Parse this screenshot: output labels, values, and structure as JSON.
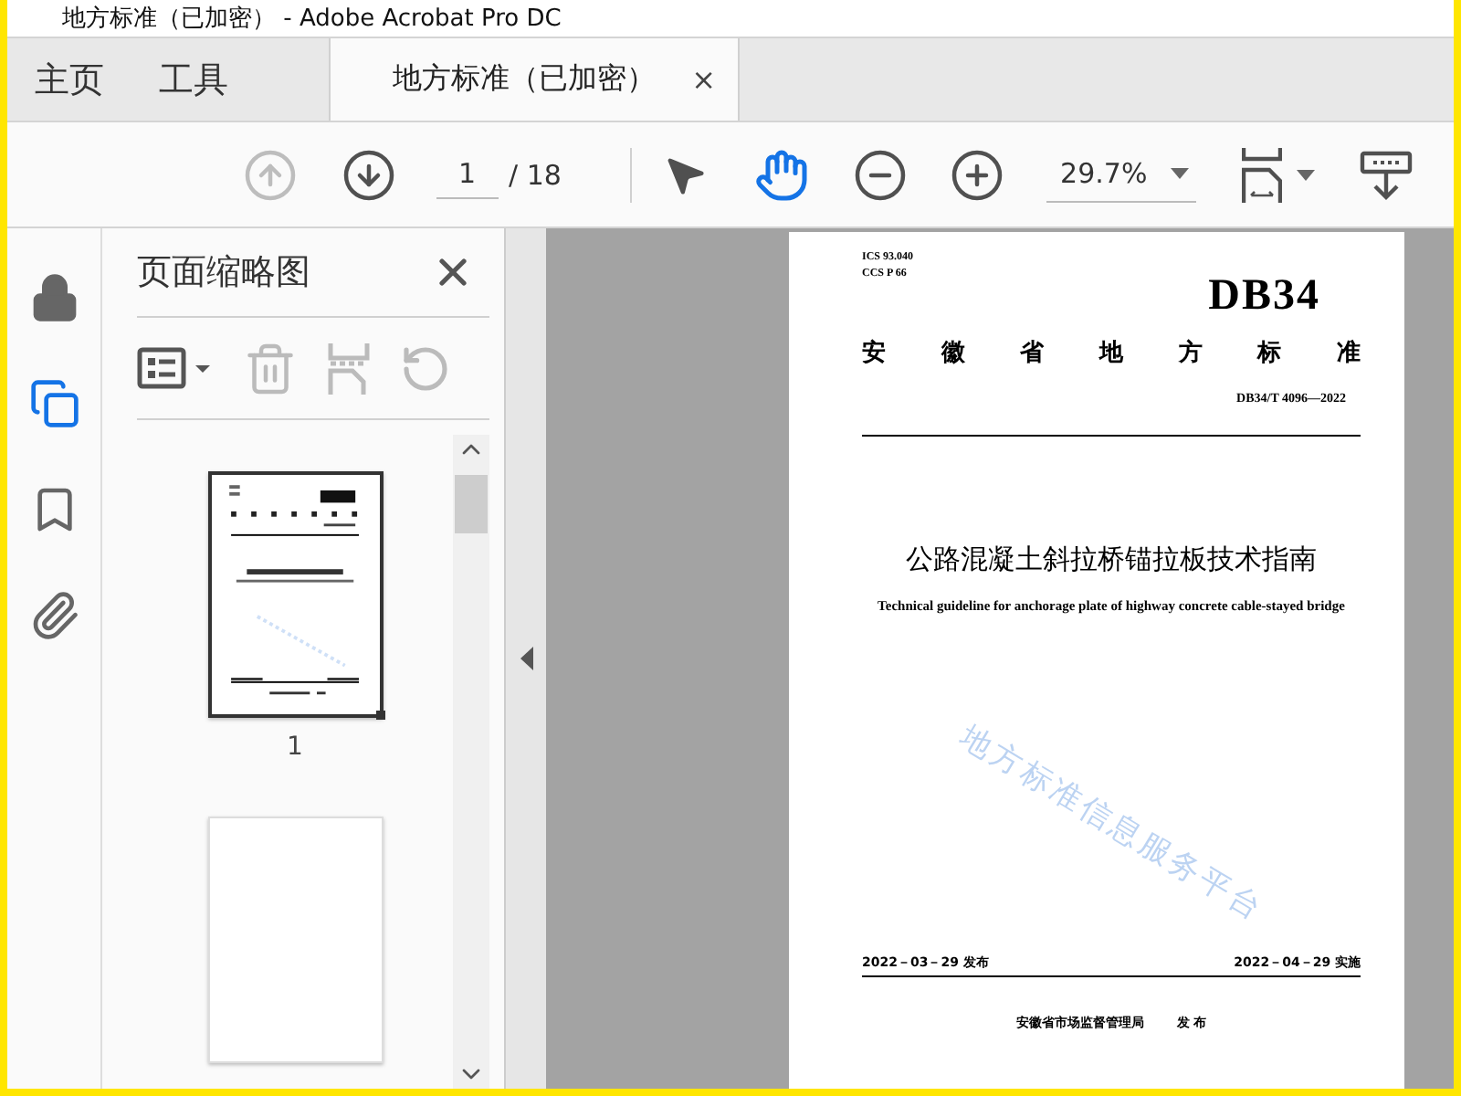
{
  "window": {
    "title": "地方标准（已加密） - Adobe Acrobat Pro DC"
  },
  "nav_tabs": [
    {
      "label": "主页",
      "selected": false
    },
    {
      "label": "工具",
      "selected": false
    }
  ],
  "document_tabs": [
    {
      "label": "地方标准（已加密）",
      "selected": true,
      "close": "×"
    }
  ],
  "toolbar": {
    "page": "1",
    "page_total": "/ 18",
    "zoom": "29.7%",
    "buttons": [
      {
        "kind": "prev-page",
        "disabled": true
      },
      {
        "kind": "next-page",
        "disabled": false
      },
      {
        "kind": "page-field"
      },
      {
        "kind": "divider"
      },
      {
        "kind": "select",
        "selected": false
      },
      {
        "kind": "hand",
        "selected": true
      },
      {
        "kind": "zoom-out",
        "disabled": false
      },
      {
        "kind": "zoom-in",
        "disabled": false
      },
      {
        "kind": "zoom-field"
      },
      {
        "kind": "fit-page",
        "disabled": false
      },
      {
        "kind": "scroll-mode",
        "disabled": false
      }
    ]
  },
  "side_rail": [
    {
      "kind": "lock",
      "selected": false
    },
    {
      "kind": "pages",
      "selected": true
    },
    {
      "kind": "bookmark",
      "selected": false
    },
    {
      "kind": "attachment",
      "selected": false
    }
  ],
  "thumbnails_panel": {
    "title": "页面缩略图",
    "tools": [
      {
        "kind": "options",
        "disabled": false
      },
      {
        "kind": "delete",
        "disabled": true
      },
      {
        "kind": "insert",
        "disabled": true
      },
      {
        "kind": "undo",
        "disabled": true
      }
    ],
    "pages": [
      {
        "label": "1",
        "selected": true,
        "kind": "cover"
      },
      {
        "selected": false,
        "kind": "blank"
      }
    ]
  },
  "document_page": {
    "ics": "ICS 93.040",
    "ccs": "CCS P 66",
    "logo": "DB34",
    "category": "安徽省地方标准",
    "code": "DB34/T 4096—2022",
    "title": "公路混凝土斜拉桥锚拉板技术指南",
    "subtitle": "Technical guideline for anchorage plate of highway concrete cable-stayed bridge",
    "watermark": "地方标准信息服务平台",
    "issue_date": "2022－03－29 发布",
    "effective_date": "2022－04－29 实施",
    "issuer": "安徽省市场监督管理局",
    "issue_word": "发 布"
  }
}
